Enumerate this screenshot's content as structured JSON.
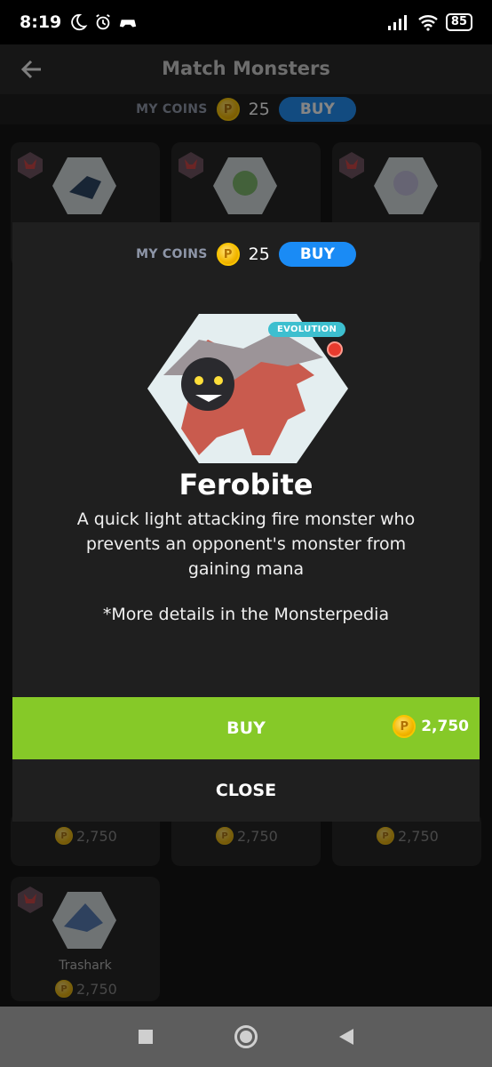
{
  "status_bar": {
    "time": "8:19",
    "battery": "85"
  },
  "app": {
    "title": "Match Monsters"
  },
  "coins": {
    "label": "MY COINS",
    "count": "25",
    "buy_label": "BUY"
  },
  "cards": [
    {
      "name": "",
      "price": "2,750"
    },
    {
      "name": "",
      "price": "2,750"
    },
    {
      "name": "",
      "price": "2,750"
    },
    {
      "name": "Trashark",
      "price": "2,750"
    }
  ],
  "dialog": {
    "coins_label": "MY COINS",
    "coins_count": "25",
    "coins_buy_label": "BUY",
    "badge": "EVOLUTION",
    "monster_name": "Ferobite",
    "description": "A quick light attacking fire monster who prevents an opponent's monster from gaining mana",
    "note": "*More details in the Monsterpedia",
    "buy_label": "BUY",
    "buy_price": "2,750",
    "close_label": "CLOSE"
  },
  "colors": {
    "buy_green": "#86c928",
    "accent_blue": "#1a8bf5",
    "evolution_teal": "#3dbfcf",
    "coin_gold": "#f3b700"
  }
}
